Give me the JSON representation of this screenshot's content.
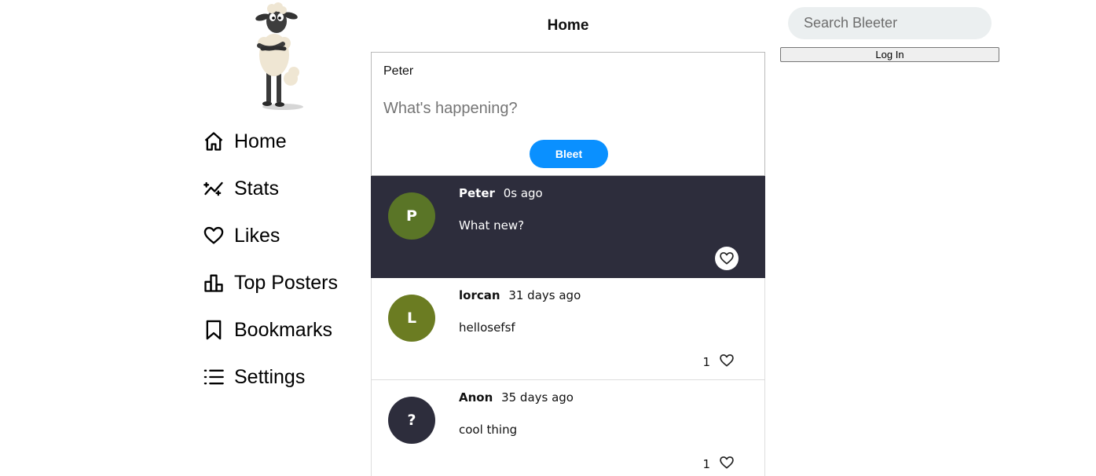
{
  "logo": {
    "icon": "sheep-mascot-logo"
  },
  "nav": {
    "items": [
      {
        "label": "Home",
        "icon": "home-icon"
      },
      {
        "label": "Stats",
        "icon": "sparkle-chart-icon"
      },
      {
        "label": "Likes",
        "icon": "heart-icon"
      },
      {
        "label": "Top Posters",
        "icon": "bar-chart-icon"
      },
      {
        "label": "Bookmarks",
        "icon": "bookmark-icon"
      },
      {
        "label": "Settings",
        "icon": "list-icon"
      }
    ]
  },
  "header": {
    "title": "Home"
  },
  "composer": {
    "username": "Peter",
    "placeholder": "What's happening?",
    "value": "",
    "button_label": "Bleet"
  },
  "feed": {
    "posts": [
      {
        "avatar_letter": "P",
        "avatar_color": "#5a7527",
        "author": "Peter",
        "time": "0s ago",
        "text": "What new?",
        "likes": ""
      },
      {
        "avatar_letter": "L",
        "avatar_color": "#6b7c22",
        "author": "lorcan",
        "time": "31 days ago",
        "text": "hellosefsf",
        "likes": "1"
      },
      {
        "avatar_letter": "?",
        "avatar_color": "#2d2d3c",
        "author": "Anon",
        "time": "35 days ago",
        "text": "cool thing",
        "likes": "1"
      }
    ]
  },
  "search": {
    "placeholder": "Search Bleeter",
    "value": ""
  },
  "auth": {
    "login_label": "Log In"
  },
  "colors": {
    "accent": "#0a90ff",
    "highlight_post_bg": "#2d2d3c",
    "search_bg": "#ebeff0"
  }
}
